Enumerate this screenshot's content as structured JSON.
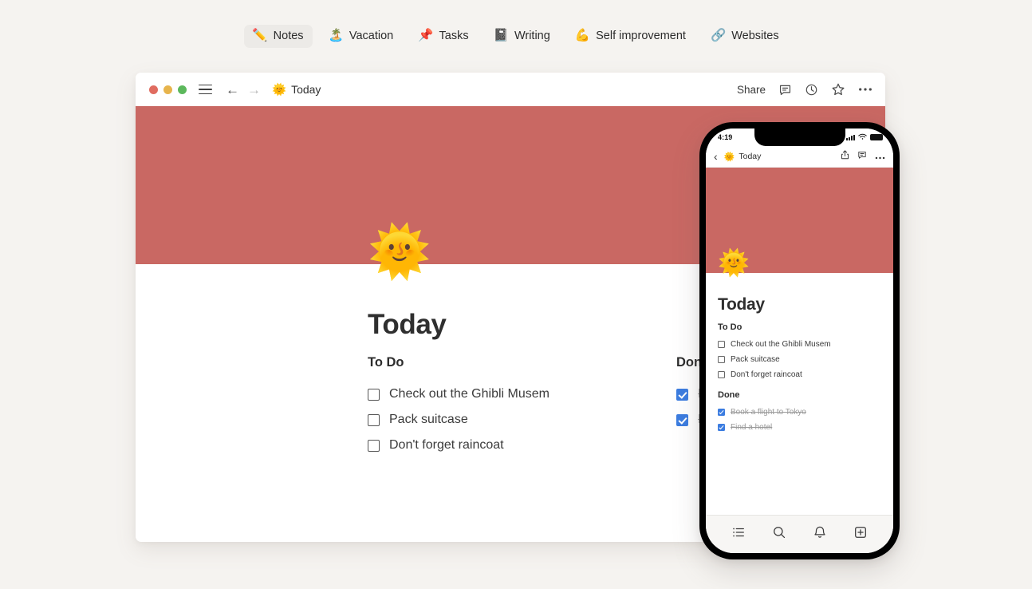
{
  "tabbar": {
    "items": [
      {
        "emoji": "✏️",
        "icon": "pencil-icon",
        "label": "Notes",
        "active": true
      },
      {
        "emoji": "🏝️",
        "icon": "island-icon",
        "label": "Vacation",
        "active": false
      },
      {
        "emoji": "📌",
        "icon": "pushpin-icon",
        "label": "Tasks",
        "active": false
      },
      {
        "emoji": "📓",
        "icon": "notebook-icon",
        "label": "Writing",
        "active": false
      },
      {
        "emoji": "💪",
        "icon": "flexed-biceps-icon",
        "label": "Self improvement",
        "active": false
      },
      {
        "emoji": "🔗",
        "icon": "link-icon",
        "label": "Websites",
        "active": false
      }
    ]
  },
  "desktop": {
    "titlebar": {
      "doc_emoji": "🌞",
      "doc_title": "Today",
      "back_arrow": "←",
      "forward_arrow": "→",
      "share_label": "Share"
    },
    "page": {
      "emoji": "🌞",
      "title": "Today",
      "cover_color": "#c96863",
      "columns": [
        {
          "heading": "To Do",
          "tasks": [
            {
              "label": "Check out the Ghibli Musem",
              "checked": false
            },
            {
              "label": "Pack suitcase",
              "checked": false
            },
            {
              "label": "Don't forget raincoat",
              "checked": false
            }
          ]
        },
        {
          "heading": "Done",
          "tasks": [
            {
              "label": "Book a flight to Tokyo",
              "checked": true
            },
            {
              "label": "Find a hotel",
              "checked": true
            }
          ]
        }
      ]
    }
  },
  "phone": {
    "status": {
      "time": "4:19"
    },
    "header": {
      "back": "‹",
      "doc_emoji": "🌞",
      "doc_title": "Today"
    },
    "page": {
      "emoji": "🌞",
      "title": "Today",
      "cover_color": "#c96863",
      "sections": [
        {
          "heading": "To Do",
          "tasks": [
            {
              "label": "Check out the Ghibli Musem",
              "checked": false
            },
            {
              "label": "Pack suitcase",
              "checked": false
            },
            {
              "label": "Don't forget raincoat",
              "checked": false
            }
          ]
        },
        {
          "heading": "Done",
          "tasks": [
            {
              "label": "Book a flight to Tokyo",
              "checked": true
            },
            {
              "label": "Find a hotel",
              "checked": true
            }
          ]
        }
      ]
    },
    "tabbar": {
      "items": [
        {
          "icon": "list-icon"
        },
        {
          "icon": "search-icon"
        },
        {
          "icon": "bell-icon"
        },
        {
          "icon": "plus-square-icon"
        }
      ]
    }
  },
  "theme": {
    "background": "#f5f3f0",
    "cover_red": "#c96863",
    "checkbox_blue": "#3b7ce0",
    "text_primary": "#2f2f2f",
    "text_muted": "#9a9a9a"
  }
}
